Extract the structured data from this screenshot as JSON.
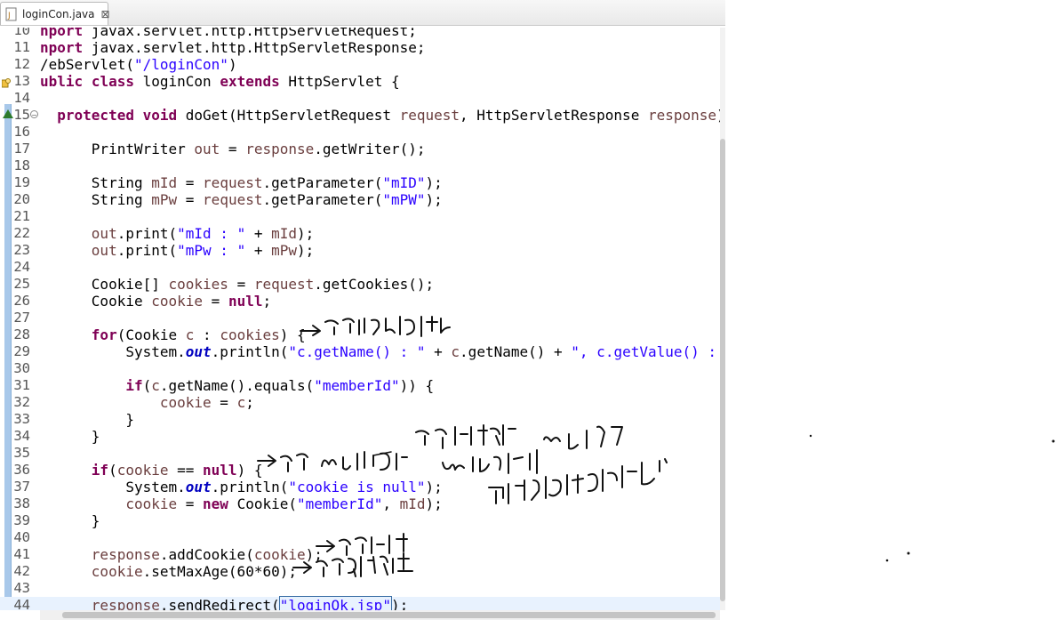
{
  "tab": {
    "label": "loginCon.java",
    "close": "⊠"
  },
  "lines": [
    {
      "n": "10",
      "t": "nport javax.servlet.http.HttpServletRequest;"
    },
    {
      "n": "11",
      "t": "nport javax.servlet.http.HttpServletResponse;"
    },
    {
      "n": "12",
      "t": "/ebServlet(\"/loginCon\")"
    },
    {
      "n": "13",
      "t": "ublic class loginCon extends HttpServlet {"
    },
    {
      "n": "14",
      "t": ""
    },
    {
      "n": "15",
      "t": "  protected void doGet(HttpServletRequest request, HttpServletResponse response) thro"
    },
    {
      "n": "16",
      "t": ""
    },
    {
      "n": "17",
      "t": "      PrintWriter out = response.getWriter();"
    },
    {
      "n": "18",
      "t": ""
    },
    {
      "n": "19",
      "t": "      String mId = request.getParameter(\"mID\");"
    },
    {
      "n": "20",
      "t": "      String mPw = request.getParameter(\"mPW\");"
    },
    {
      "n": "21",
      "t": ""
    },
    {
      "n": "22",
      "t": "      out.print(\"mId : \" + mId);"
    },
    {
      "n": "23",
      "t": "      out.print(\"mPw : \" + mPw);"
    },
    {
      "n": "24",
      "t": ""
    },
    {
      "n": "25",
      "t": "      Cookie[] cookies = request.getCookies();"
    },
    {
      "n": "26",
      "t": "      Cookie cookie = null;"
    },
    {
      "n": "27",
      "t": ""
    },
    {
      "n": "28",
      "t": "      for(Cookie c : cookies) {"
    },
    {
      "n": "29",
      "t": "          System.out.println(\"c.getName() : \" + c.getName() + \", c.getValue() : \" + c"
    },
    {
      "n": "30",
      "t": ""
    },
    {
      "n": "31",
      "t": "          if(c.getName().equals(\"memberId\")) {"
    },
    {
      "n": "32",
      "t": "              cookie = c;"
    },
    {
      "n": "33",
      "t": "          }"
    },
    {
      "n": "34",
      "t": "      }"
    },
    {
      "n": "35",
      "t": ""
    },
    {
      "n": "36",
      "t": "      if(cookie == null) {"
    },
    {
      "n": "37",
      "t": "          System.out.println(\"cookie is null\");"
    },
    {
      "n": "38",
      "t": "          cookie = new Cookie(\"memberId\", mId);"
    },
    {
      "n": "39",
      "t": "      }"
    },
    {
      "n": "40",
      "t": ""
    },
    {
      "n": "41",
      "t": "      response.addCookie(cookie);"
    },
    {
      "n": "42",
      "t": "      cookie.setMaxAge(60*60);"
    },
    {
      "n": "43",
      "t": ""
    },
    {
      "n": "44",
      "t": "      response.sendRedirect(\"loginOk.jsp\");"
    }
  ],
  "colors": {
    "keyword": "#7f0055",
    "string": "#2a00ff",
    "variable": "#6a3e3e",
    "field": "#0000c0",
    "current_line": "#e8f2fe"
  }
}
